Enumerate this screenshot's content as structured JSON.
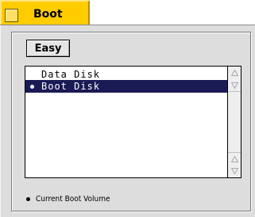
{
  "tab": {
    "title": "Boot",
    "color": "#ffcc00"
  },
  "toolbar": {
    "easy_label": "Easy"
  },
  "disk_list": {
    "items": [
      {
        "label": "Data Disk",
        "selected": false,
        "current_boot": false
      },
      {
        "label": "Boot Disk",
        "selected": true,
        "current_boot": true
      }
    ],
    "selection_color": "#1a1a55"
  },
  "legend": {
    "label": "Current Boot Volume",
    "icon": "bullet-icon"
  },
  "scrollbar": {
    "icons": [
      "scroll-up-arrow-icon",
      "scroll-down-arrow-icon",
      "scroll-up-arrow-icon",
      "scroll-down-arrow-icon"
    ]
  }
}
